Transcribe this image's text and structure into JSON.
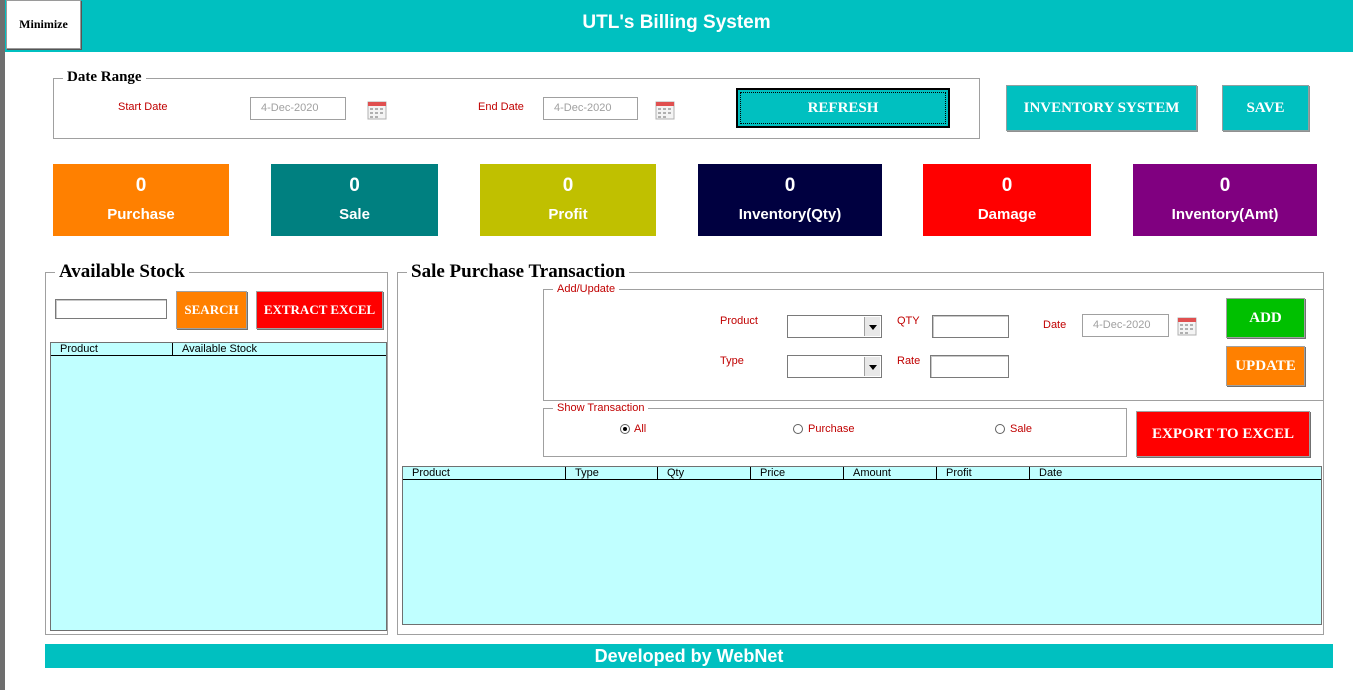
{
  "header": {
    "minimize_label": "Minimize",
    "title": "UTL's Billing System"
  },
  "date_range": {
    "legend": "Date Range",
    "start_label": "Start Date",
    "start_value": "4-Dec-2020",
    "end_label": "End Date",
    "end_value": "4-Dec-2020",
    "refresh_label": "REFRESH"
  },
  "toolbar": {
    "inventory_label": "INVENTORY SYSTEM",
    "save_label": "SAVE"
  },
  "stats": [
    {
      "value": "0",
      "label": "Purchase",
      "color": "#ff8000"
    },
    {
      "value": "0",
      "label": "Sale",
      "color": "#008080"
    },
    {
      "value": "0",
      "label": "Profit",
      "color": "#c0c000"
    },
    {
      "value": "0",
      "label": "Inventory(Qty)",
      "color": "#000040"
    },
    {
      "value": "0",
      "label": "Damage",
      "color": "#ff0000"
    },
    {
      "value": "0",
      "label": "Inventory(Amt)",
      "color": "#800080"
    }
  ],
  "stock": {
    "legend": "Available Stock",
    "search_value": "",
    "search_label": "SEARCH",
    "extract_label": "EXTRACT EXCEL",
    "columns": [
      "Product",
      "Available Stock"
    ]
  },
  "transaction": {
    "legend": "Sale Purchase Transaction",
    "add_update_legend": "Add/Update",
    "product_label": "Product",
    "product_value": "",
    "qty_label": "QTY",
    "qty_value": "",
    "date_label": "Date",
    "date_value": "4-Dec-2020",
    "type_label": "Type",
    "type_value": "",
    "rate_label": "Rate",
    "rate_value": "",
    "add_label": "ADD",
    "update_label": "UPDATE",
    "show_legend": "Show Transaction",
    "radio_all": "All",
    "radio_purchase": "Purchase",
    "radio_sale": "Sale",
    "selected_filter": "All",
    "export_label": "EXPORT TO EXCEL",
    "columns": [
      "Product",
      "Type",
      "Qty",
      "Price",
      "Amount",
      "Profit",
      "Date"
    ]
  },
  "footer": {
    "text": "Developed by WebNet"
  },
  "colors": {
    "accent": "#00c0c0",
    "grid_bg": "#c0ffff",
    "label_red": "#c00000",
    "add_green": "#00c000",
    "orange": "#ff8000",
    "red": "#ff0000"
  }
}
